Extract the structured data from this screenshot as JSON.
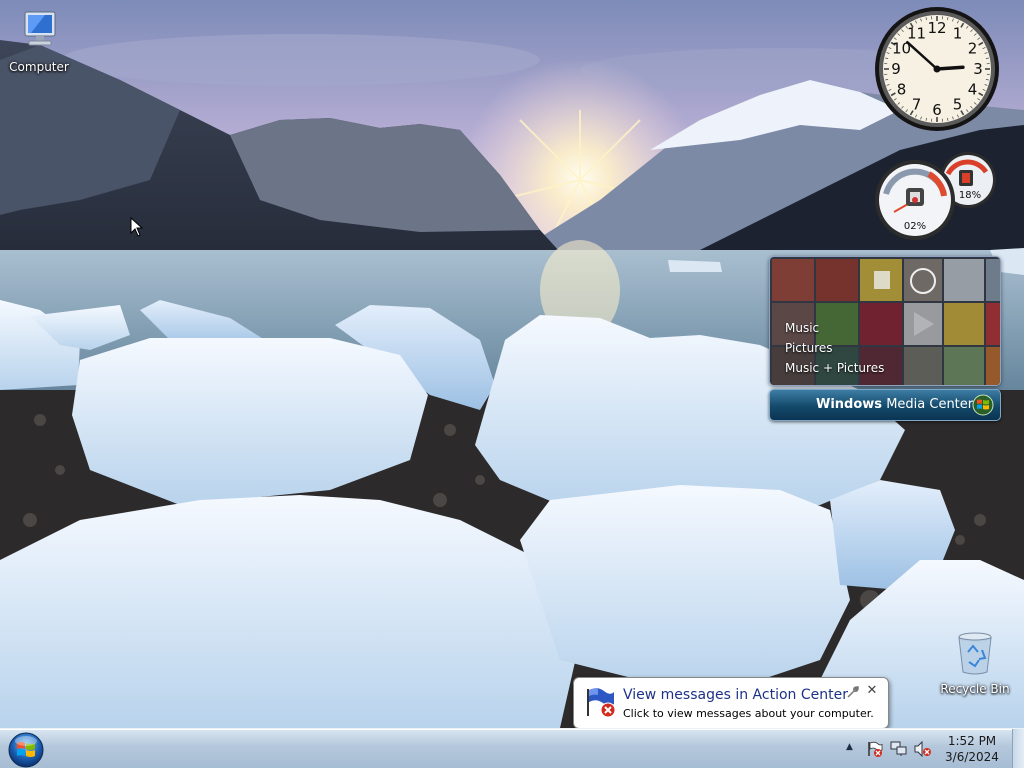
{
  "desktop": {
    "icons": [
      {
        "label": "Computer",
        "icon": "computer-icon"
      },
      {
        "label": "Recycle Bin",
        "icon": "recycle-bin-icon"
      }
    ]
  },
  "gadgets": {
    "clock": {
      "hour": 2,
      "minute": 52,
      "numerals": [
        "12",
        "1",
        "2",
        "3",
        "4",
        "5",
        "6",
        "7",
        "8",
        "9",
        "10",
        "11"
      ]
    },
    "cpu_meter": {
      "cpu_percent": "02%",
      "memory_percent": "18%"
    },
    "media_center": {
      "menu": [
        "Music",
        "Pictures",
        "Music + Pictures"
      ],
      "brand_bold": "Windows",
      "brand_light": "Media Center"
    }
  },
  "notification": {
    "title": "View messages in Action Center",
    "text": "Click to view messages about your computer."
  },
  "taskbar": {
    "start_icon": "windows-orb-icon",
    "tray_icons": [
      "action-center-flag-icon",
      "network-icon",
      "volume-muted-icon"
    ],
    "time": "1:52 PM",
    "date": "3/6/2024"
  },
  "colors": {
    "taskbar": "#b4c7db",
    "balloon_title": "#1e3287",
    "media_center_bar": "#134a6b"
  }
}
